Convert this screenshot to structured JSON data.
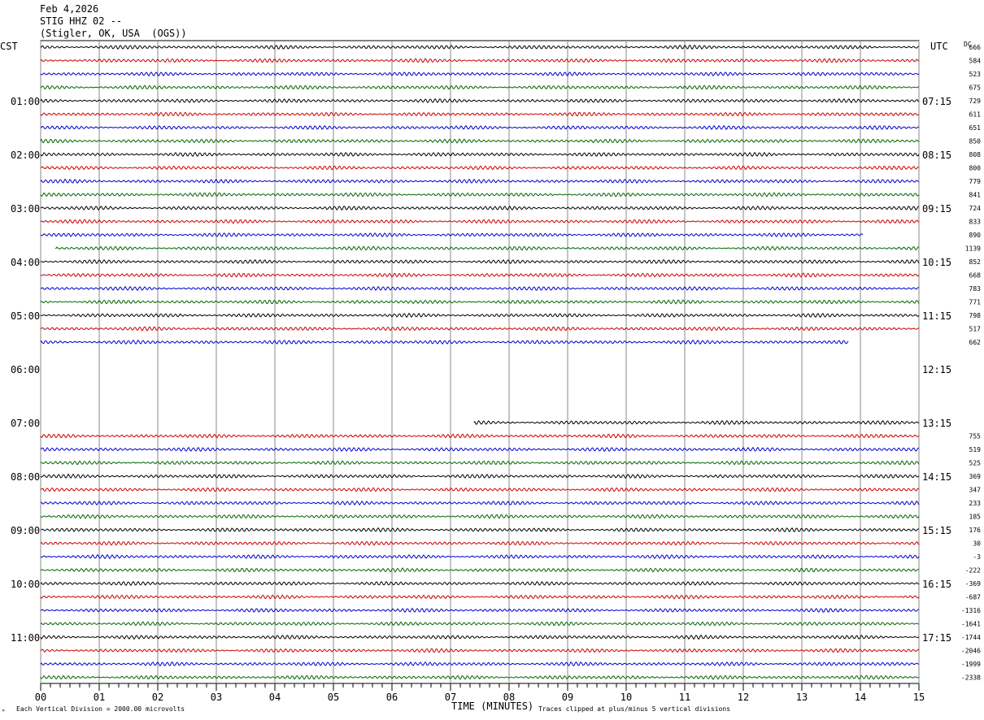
{
  "header": {
    "date": "Feb 4,2026",
    "station": "STIG HHZ 02 --",
    "location": "(Stigler, OK, USA  (OGS))"
  },
  "left_tz": "CST",
  "right_tz": "UTC",
  "dc_label": "DC",
  "footer": {
    "scale_note": "Each Vertical Division = 2000.00 microvolts",
    "clip_note": "Traces clipped at plus/minus 5 vertical divisions",
    "corner_mark": "ᴹ"
  },
  "chart_data": {
    "type": "line",
    "title": "",
    "xlabel": "TIME (MINUTES)",
    "ylabel": "",
    "xlim": [
      0,
      15
    ],
    "x_ticks": [
      "00",
      "01",
      "02",
      "03",
      "04",
      "05",
      "06",
      "07",
      "08",
      "09",
      "10",
      "11",
      "12",
      "13",
      "14",
      "15"
    ],
    "colors": [
      "#000000",
      "#cc0000",
      "#0000cc",
      "#006600"
    ],
    "left_time_labels": [
      {
        "row": 4,
        "text": "01:00"
      },
      {
        "row": 8,
        "text": "02:00"
      },
      {
        "row": 12,
        "text": "03:00"
      },
      {
        "row": 16,
        "text": "04:00"
      },
      {
        "row": 20,
        "text": "05:00"
      },
      {
        "row": 24,
        "text": "06:00"
      },
      {
        "row": 28,
        "text": "07:00"
      },
      {
        "row": 32,
        "text": "08:00"
      },
      {
        "row": 36,
        "text": "09:00"
      },
      {
        "row": 40,
        "text": "10:00"
      },
      {
        "row": 44,
        "text": "11:00"
      }
    ],
    "right_time_labels": [
      {
        "row": 4,
        "text": "07:15"
      },
      {
        "row": 8,
        "text": "08:15"
      },
      {
        "row": 12,
        "text": "09:15"
      },
      {
        "row": 16,
        "text": "10:15"
      },
      {
        "row": 20,
        "text": "11:15"
      },
      {
        "row": 24,
        "text": "12:15"
      },
      {
        "row": 28,
        "text": "13:15"
      },
      {
        "row": 32,
        "text": "14:15"
      },
      {
        "row": 36,
        "text": "15:15"
      },
      {
        "row": 40,
        "text": "16:15"
      },
      {
        "row": 44,
        "text": "17:15"
      }
    ],
    "rows": [
      {
        "dc": "666",
        "start": 0,
        "end": 15
      },
      {
        "dc": "584",
        "start": 0,
        "end": 15
      },
      {
        "dc": "523",
        "start": 0,
        "end": 15
      },
      {
        "dc": "675",
        "start": 0,
        "end": 15
      },
      {
        "dc": "729",
        "start": 0,
        "end": 15
      },
      {
        "dc": "611",
        "start": 0,
        "end": 15
      },
      {
        "dc": "651",
        "start": 0,
        "end": 15
      },
      {
        "dc": "850",
        "start": 0,
        "end": 15
      },
      {
        "dc": "808",
        "start": 0,
        "end": 15
      },
      {
        "dc": "800",
        "start": 0,
        "end": 15
      },
      {
        "dc": "779",
        "start": 0,
        "end": 15
      },
      {
        "dc": "841",
        "start": 0,
        "end": 15
      },
      {
        "dc": "724",
        "start": 0,
        "end": 15
      },
      {
        "dc": "833",
        "start": 0,
        "end": 15
      },
      {
        "dc": "890",
        "start": 0,
        "end": 14.05
      },
      {
        "dc": "1139",
        "start": 0.25,
        "end": 15
      },
      {
        "dc": "852",
        "start": 0,
        "end": 15
      },
      {
        "dc": "668",
        "start": 0,
        "end": 15
      },
      {
        "dc": "783",
        "start": 0,
        "end": 15
      },
      {
        "dc": "771",
        "start": 0,
        "end": 15
      },
      {
        "dc": "798",
        "start": 0,
        "end": 15
      },
      {
        "dc": "517",
        "start": 0,
        "end": 15
      },
      {
        "dc": "662",
        "start": 0,
        "end": 13.8
      },
      {
        "dc": "",
        "start": null,
        "end": null
      },
      {
        "dc": "",
        "start": null,
        "end": null
      },
      {
        "dc": "",
        "start": null,
        "end": null
      },
      {
        "dc": "",
        "start": null,
        "end": null
      },
      {
        "dc": "",
        "start": null,
        "end": null
      },
      {
        "dc": "",
        "start": 7.4,
        "end": 15
      },
      {
        "dc": "755",
        "start": 0,
        "end": 15
      },
      {
        "dc": "519",
        "start": 0,
        "end": 15
      },
      {
        "dc": "525",
        "start": 0,
        "end": 15
      },
      {
        "dc": "369",
        "start": 0,
        "end": 15
      },
      {
        "dc": "347",
        "start": 0,
        "end": 15
      },
      {
        "dc": "233",
        "start": 0,
        "end": 15
      },
      {
        "dc": "185",
        "start": 0,
        "end": 15
      },
      {
        "dc": "176",
        "start": 0,
        "end": 15
      },
      {
        "dc": "30",
        "start": 0,
        "end": 15
      },
      {
        "dc": "-3",
        "start": 0,
        "end": 15
      },
      {
        "dc": "-222",
        "start": 0,
        "end": 15
      },
      {
        "dc": "-369",
        "start": 0,
        "end": 15
      },
      {
        "dc": "-687",
        "start": 0,
        "end": 15
      },
      {
        "dc": "-1316",
        "start": 0,
        "end": 15
      },
      {
        "dc": "-1641",
        "start": 0,
        "end": 15
      },
      {
        "dc": "-1744",
        "start": 0,
        "end": 15
      },
      {
        "dc": "-2046",
        "start": 0,
        "end": 15
      },
      {
        "dc": "-1999",
        "start": 0,
        "end": 15
      },
      {
        "dc": "-2338",
        "start": 0,
        "end": 15
      }
    ]
  }
}
